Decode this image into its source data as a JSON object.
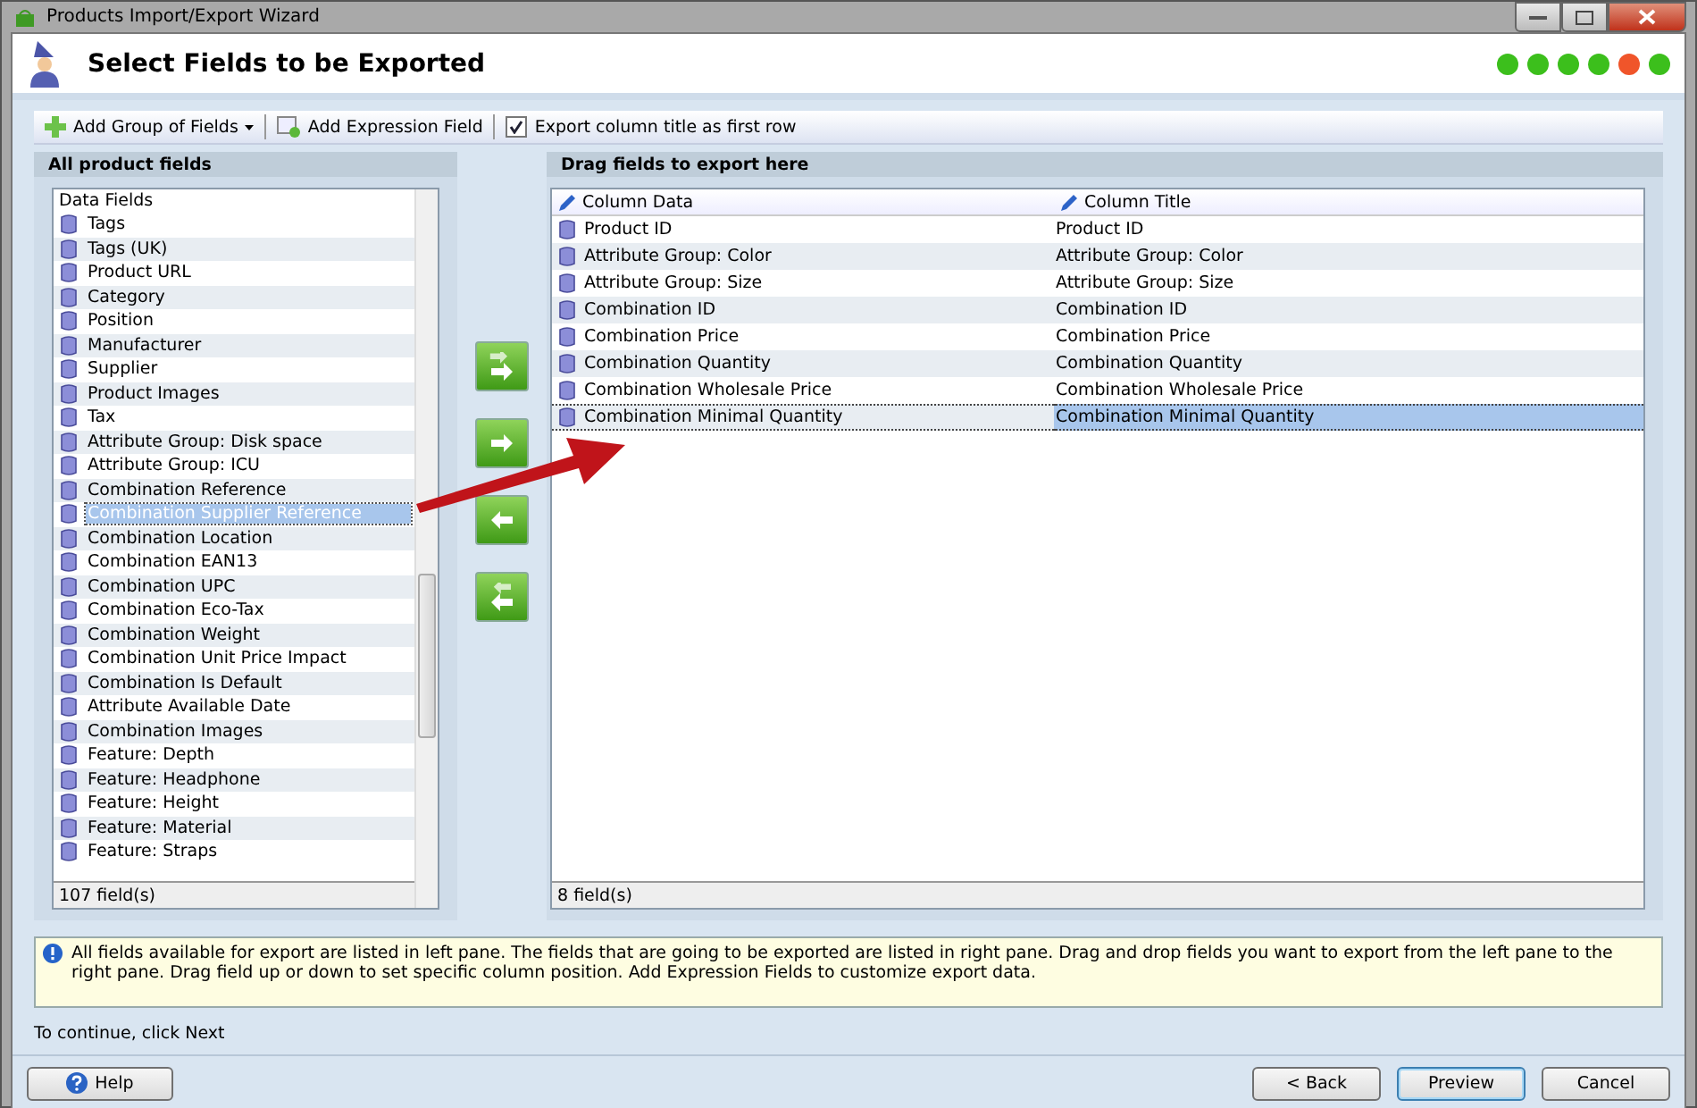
{
  "window": {
    "title": "Products Import/Export Wizard"
  },
  "header": {
    "title": "Select Fields to be Exported",
    "steps": [
      {
        "color": "#3cbf1c"
      },
      {
        "color": "#3cbf1c"
      },
      {
        "color": "#3cbf1c"
      },
      {
        "color": "#3cbf1c"
      },
      {
        "color": "#f0552a"
      },
      {
        "color": "#3cbf1c"
      }
    ]
  },
  "toolbar": {
    "add_group": "Add Group of Fields",
    "add_expression": "Add Expression Field",
    "export_titles": {
      "label": "Export column title as first row",
      "checked": true
    }
  },
  "left_pane": {
    "title": "All product fields",
    "list_header": "Data Fields",
    "status": "107 field(s)",
    "items": [
      {
        "label": "Tags",
        "selected": false
      },
      {
        "label": "Tags (UK)",
        "selected": false
      },
      {
        "label": "Product URL",
        "selected": false
      },
      {
        "label": "Category",
        "selected": false
      },
      {
        "label": "Position",
        "selected": false
      },
      {
        "label": "Manufacturer",
        "selected": false
      },
      {
        "label": "Supplier",
        "selected": false
      },
      {
        "label": "Product Images",
        "selected": false
      },
      {
        "label": "Tax",
        "selected": false
      },
      {
        "label": "Attribute Group: Disk space",
        "selected": false
      },
      {
        "label": "Attribute Group: ICU",
        "selected": false
      },
      {
        "label": "Combination Reference",
        "selected": false
      },
      {
        "label": "Combination Supplier Reference",
        "selected": true
      },
      {
        "label": "Combination Location",
        "selected": false
      },
      {
        "label": "Combination EAN13",
        "selected": false
      },
      {
        "label": "Combination UPC",
        "selected": false
      },
      {
        "label": "Combination Eco-Tax",
        "selected": false
      },
      {
        "label": "Combination Weight",
        "selected": false
      },
      {
        "label": "Combination Unit Price Impact",
        "selected": false
      },
      {
        "label": "Combination Is Default",
        "selected": false
      },
      {
        "label": "Attribute Available Date",
        "selected": false
      },
      {
        "label": "Combination Images",
        "selected": false
      },
      {
        "label": "Feature: Depth",
        "selected": false
      },
      {
        "label": "Feature: Headphone",
        "selected": false
      },
      {
        "label": "Feature: Height",
        "selected": false
      },
      {
        "label": "Feature: Material",
        "selected": false
      },
      {
        "label": "Feature: Straps",
        "selected": false
      }
    ]
  },
  "right_pane": {
    "title": "Drag fields to export here",
    "columns": [
      "Column Data",
      "Column Title"
    ],
    "status": "8 field(s)",
    "rows": [
      {
        "data": "Product ID",
        "title": "Product ID",
        "selected": false
      },
      {
        "data": "Attribute Group: Color",
        "title": "Attribute Group: Color",
        "selected": false
      },
      {
        "data": "Attribute Group: Size",
        "title": "Attribute Group: Size",
        "selected": false
      },
      {
        "data": "Combination ID",
        "title": "Combination ID",
        "selected": false
      },
      {
        "data": "Combination Price",
        "title": "Combination Price",
        "selected": false
      },
      {
        "data": "Combination Quantity",
        "title": "Combination Quantity",
        "selected": false
      },
      {
        "data": "Combination Wholesale Price",
        "title": "Combination Wholesale Price",
        "selected": false
      },
      {
        "data": "Combination Minimal Quantity",
        "title": "Combination Minimal Quantity",
        "selected": true
      }
    ]
  },
  "info": "All fields available for export are listed in left pane. The fields that are going to be exported are listed in right pane. Drag and drop fields you want to export from the left pane to the right pane. Drag field up or down to set specific column position. Add Expression Fields to customize export data.",
  "hint": "To continue, click Next",
  "buttons": {
    "help": "Help",
    "back": "< Back",
    "preview": "Preview",
    "cancel": "Cancel"
  }
}
